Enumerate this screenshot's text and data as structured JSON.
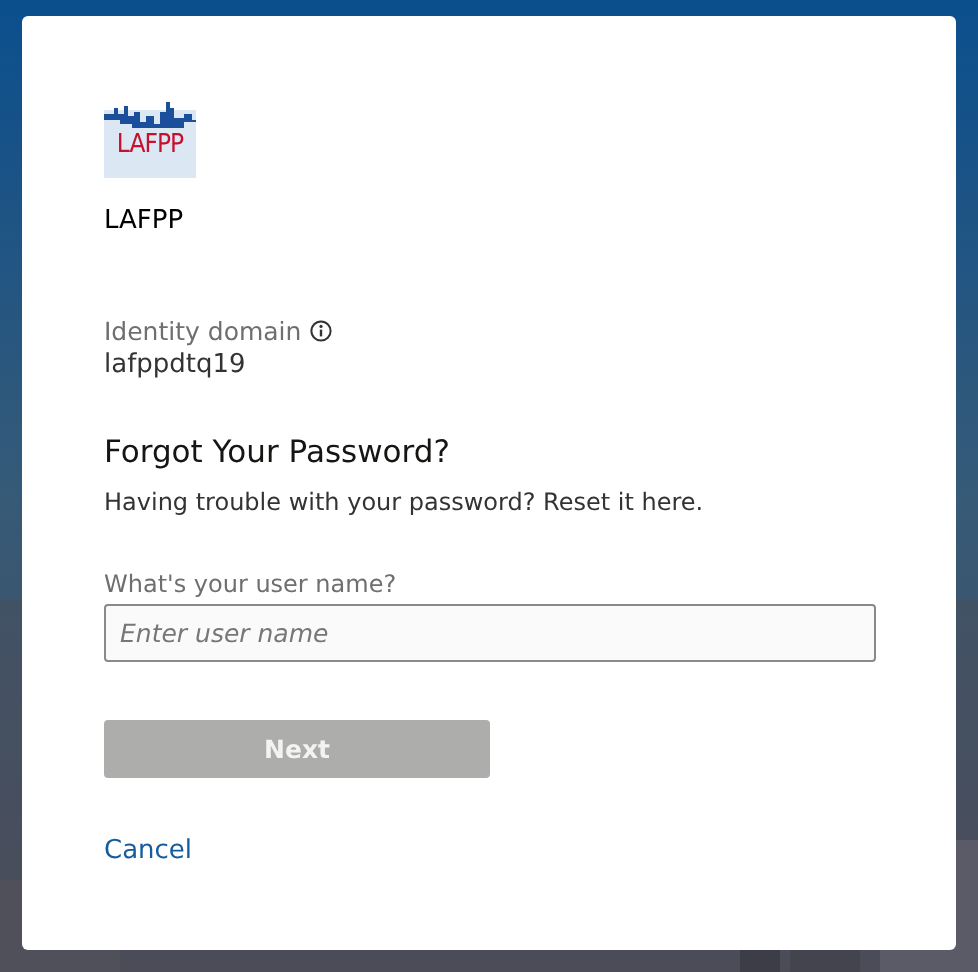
{
  "logo": {
    "text": "LAFPP"
  },
  "organization": "LAFPP",
  "identity_domain": {
    "label": "Identity domain",
    "value": "lafppdtq19"
  },
  "heading": "Forgot Your Password?",
  "description": "Having trouble with your password? Reset it here.",
  "user_name_field": {
    "label": "What's your user name?",
    "placeholder": "Enter user name"
  },
  "next_button": {
    "label": "Next",
    "disabled": true
  },
  "cancel_link": "Cancel"
}
